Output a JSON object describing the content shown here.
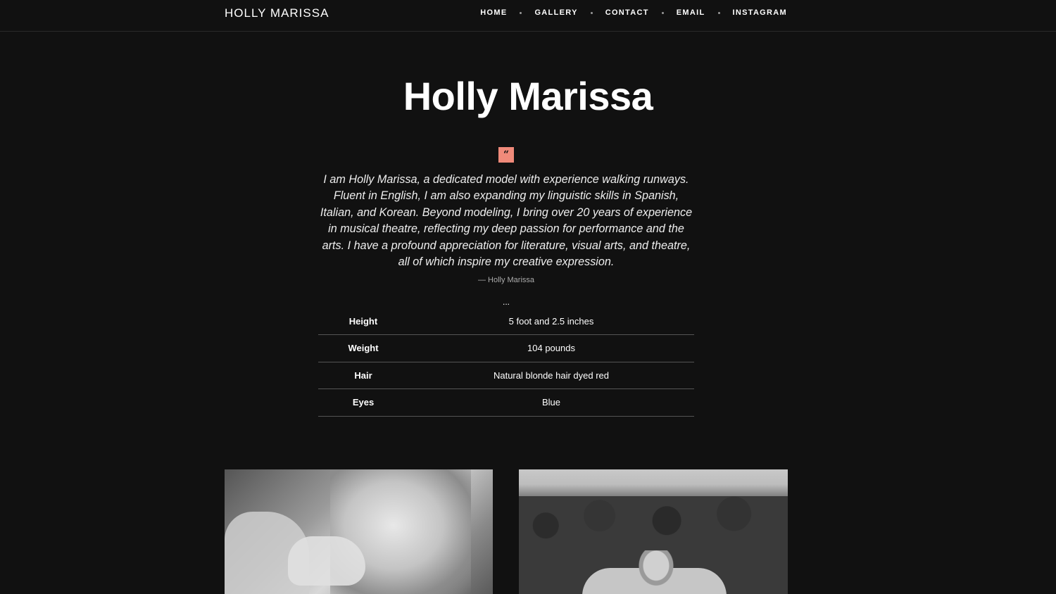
{
  "header": {
    "brand": "HOLLY MARISSA",
    "nav": [
      {
        "label": "HOME"
      },
      {
        "label": "GALLERY"
      },
      {
        "label": "CONTACT"
      },
      {
        "label": "EMAIL"
      },
      {
        "label": "INSTAGRAM"
      }
    ]
  },
  "hero": {
    "title": "Holly Marissa",
    "quote_mark": "“",
    "quote": "I am Holly Marissa, a dedicated model with experience walking runways. Fluent in English, I am also expanding my linguistic skills in Spanish, Italian, and Korean. Beyond modeling, I bring over 20 years of experience in musical theatre, reflecting my deep passion for performance and the arts. I have a profound appreciation for literature, visual arts, and theatre, all of which inspire my creative expression.",
    "cite": "— Holly Marissa",
    "ellipsis": "..."
  },
  "stats": [
    {
      "label": "Height",
      "value": "5 foot and 2.5 inches"
    },
    {
      "label": "Weight",
      "value": "104 pounds"
    },
    {
      "label": "Hair",
      "value": "Natural blonde hair dyed red"
    },
    {
      "label": "Eyes",
      "value": "Blue"
    }
  ],
  "colors": {
    "background": "#111111",
    "accent": "#f08a7a",
    "text": "#ffffff"
  }
}
